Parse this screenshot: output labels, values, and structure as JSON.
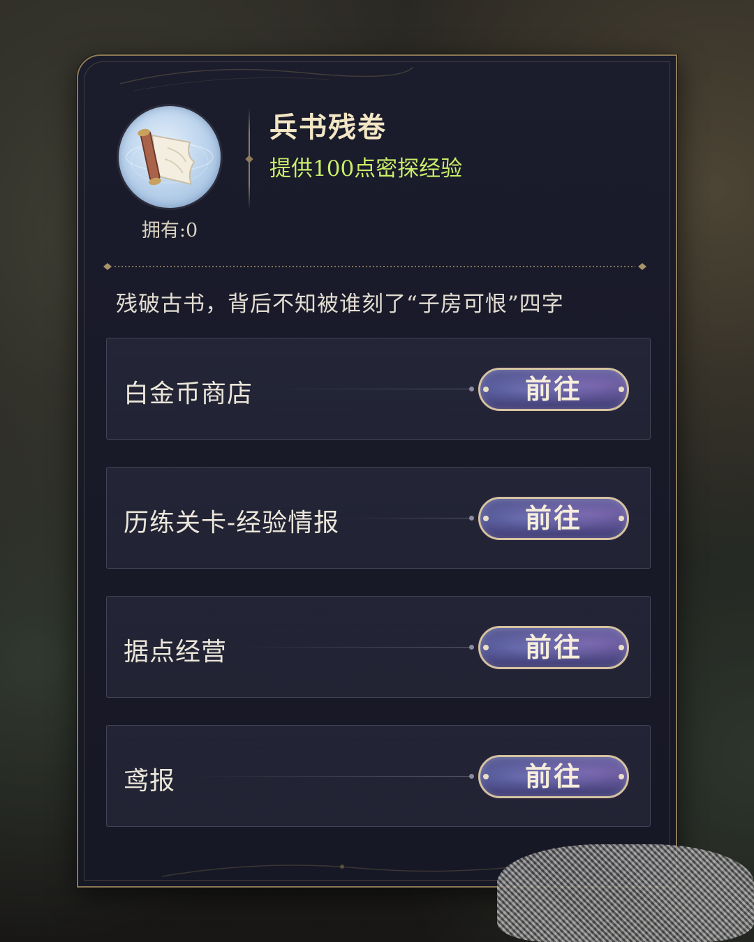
{
  "item": {
    "name": "兵书残卷",
    "effect": "提供100点密探经验",
    "owned": "拥有:0",
    "description": "残破古书，背后不知被谁刻了“子房可恨”四字",
    "icon": "scroll-icon"
  },
  "sources": [
    {
      "label": "白金币商店",
      "button": "前往"
    },
    {
      "label": "历练关卡-经验情报",
      "button": "前往"
    },
    {
      "label": "据点经营",
      "button": "前往"
    },
    {
      "label": "鸢报",
      "button": "前往"
    }
  ],
  "colors": {
    "panel_border": "#8d7a57",
    "title": "#f3e6c4",
    "effect": "#c9ee6a",
    "button_fill": "#4a4a86",
    "button_border": "#d4c3a0"
  }
}
